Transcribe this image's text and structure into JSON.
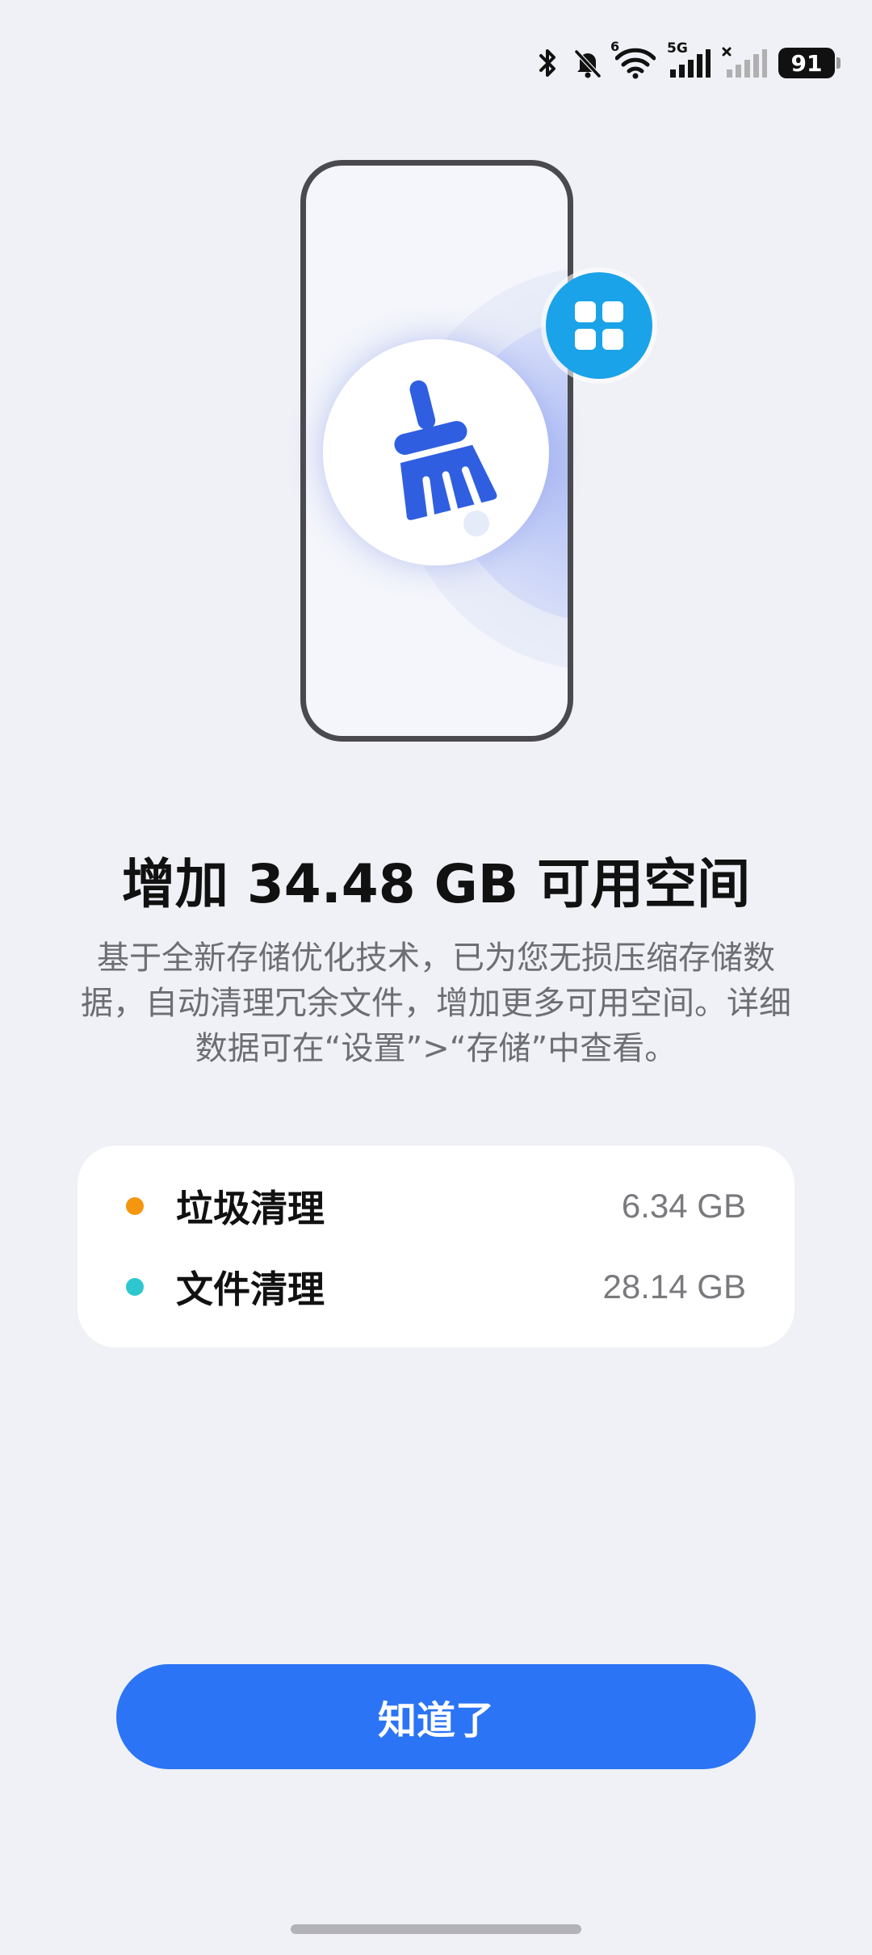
{
  "status_bar": {
    "battery_level": "91",
    "wifi_badge": "6",
    "network_type": "5G",
    "icons": [
      "bluetooth-icon",
      "bell-off-icon",
      "wifi-icon",
      "cellular-signal-icon",
      "cellular-no-signal-icon",
      "battery-icon"
    ]
  },
  "illustration": {
    "main_icon": "broom-icon",
    "badge_icon": "app-grid-icon",
    "badge_color": "#1aa3e8",
    "broom_color": "#2f5fe0"
  },
  "headline": "增加 34.48 GB 可用空间",
  "description": "基于全新存储优化技术，已为您无损压缩存储数据，自动清理冗余文件，增加更多可用空间。详细数据可在“设置”>“存储”中查看。",
  "summary": {
    "items": [
      {
        "label": "垃圾清理",
        "value": "6.34 GB",
        "dot_color": "#f5960f"
      },
      {
        "label": "文件清理",
        "value": "28.14 GB",
        "dot_color": "#2ec7cf"
      }
    ]
  },
  "button": {
    "label": "知道了",
    "color": "#2b74f5"
  }
}
